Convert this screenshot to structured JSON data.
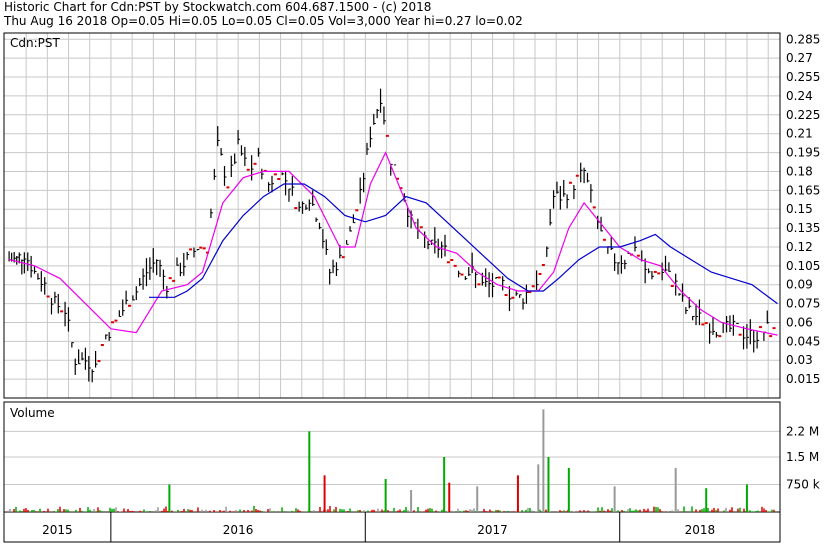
{
  "header": {
    "line1": "Historic Chart for Cdn:PST by Stockwatch.com 604.687.1500 - (c) 2018",
    "line2": "Thu Aug 16 2018  Op=0.05  Hi=0.05  Lo=0.05  Cl=0.05  Vol=3,000  Year hi=0.27  lo=0.02"
  },
  "colors": {
    "background": "#ffffff",
    "grid": "#c8c8c8",
    "price_bars": "#000000",
    "red_ticks": "#dd0000",
    "ma_short": "#ee00ee",
    "ma_long": "#0000cc",
    "volume_up": "#00aa00",
    "volume_down": "#dd0000",
    "volume_neutral": "#999999"
  },
  "chart_data": [
    {
      "type": "line",
      "title": "Cdn:PST",
      "price_label": "Cdn:PST",
      "y_ticks": [
        "0.285",
        "0.27",
        "0.255",
        "0.24",
        "0.225",
        "0.21",
        "0.195",
        "0.18",
        "0.165",
        "0.15",
        "0.135",
        "0.12",
        "0.105",
        "0.09",
        "0.075",
        "0.06",
        "0.045",
        "0.03",
        "0.015"
      ],
      "ylim": [
        0,
        0.29
      ],
      "x_ticks": [
        "2015",
        "2016",
        "2017",
        "2018"
      ],
      "xlim": [
        2015.58,
        2018.63
      ],
      "grid": true,
      "series": [
        {
          "kind": "price_close",
          "x": [
            2015.6,
            2015.63,
            2015.66,
            2015.7,
            2015.74,
            2015.78,
            2015.82,
            2015.86,
            2015.9,
            2015.94,
            2015.98,
            2016.02,
            2016.06,
            2016.1,
            2016.14,
            2016.18,
            2016.22,
            2016.26,
            2016.3,
            2016.34,
            2016.38,
            2016.42,
            2016.46,
            2016.5,
            2016.54,
            2016.58,
            2016.62,
            2016.66,
            2016.7,
            2016.74,
            2016.78,
            2016.82,
            2016.86,
            2016.9,
            2016.94,
            2016.98,
            2017.02,
            2017.06,
            2017.1,
            2017.14,
            2017.18,
            2017.22,
            2017.26,
            2017.3,
            2017.34,
            2017.38,
            2017.42,
            2017.46,
            2017.5,
            2017.54,
            2017.58,
            2017.62,
            2017.66,
            2017.7,
            2017.74,
            2017.78,
            2017.82,
            2017.86,
            2017.9,
            2017.94,
            2017.98,
            2018.02,
            2018.06,
            2018.1,
            2018.14,
            2018.18,
            2018.22,
            2018.26,
            2018.3,
            2018.34,
            2018.38,
            2018.42,
            2018.46,
            2018.5,
            2018.54,
            2018.58,
            2018.62
          ],
          "y": [
            0.11,
            0.11,
            0.115,
            0.1,
            0.09,
            0.075,
            0.07,
            0.03,
            0.03,
            0.025,
            0.05,
            0.06,
            0.075,
            0.085,
            0.1,
            0.11,
            0.09,
            0.1,
            0.11,
            0.12,
            0.12,
            0.2,
            0.17,
            0.2,
            0.18,
            0.19,
            0.17,
            0.18,
            0.17,
            0.15,
            0.16,
            0.14,
            0.1,
            0.11,
            0.13,
            0.16,
            0.21,
            0.24,
            0.19,
            0.17,
            0.14,
            0.13,
            0.12,
            0.12,
            0.11,
            0.1,
            0.1,
            0.09,
            0.09,
            0.09,
            0.08,
            0.08,
            0.09,
            0.1,
            0.16,
            0.16,
            0.17,
            0.18,
            0.15,
            0.12,
            0.11,
            0.11,
            0.12,
            0.1,
            0.1,
            0.1,
            0.09,
            0.07,
            0.065,
            0.06,
            0.055,
            0.055,
            0.055,
            0.05,
            0.05,
            0.055,
            0.05
          ]
        },
        {
          "kind": "moving_average_short",
          "x": [
            2015.6,
            2015.7,
            2015.8,
            2015.9,
            2016.0,
            2016.1,
            2016.2,
            2016.3,
            2016.36,
            2016.44,
            2016.52,
            2016.6,
            2016.7,
            2016.8,
            2016.9,
            2016.96,
            2017.02,
            2017.08,
            2017.14,
            2017.2,
            2017.28,
            2017.36,
            2017.44,
            2017.52,
            2017.6,
            2017.68,
            2017.74,
            2017.8,
            2017.86,
            2017.92,
            2018.0,
            2018.08,
            2018.16,
            2018.24,
            2018.32,
            2018.4,
            2018.5,
            2018.62
          ],
          "y": [
            0.11,
            0.105,
            0.095,
            0.075,
            0.055,
            0.052,
            0.085,
            0.09,
            0.1,
            0.155,
            0.175,
            0.18,
            0.18,
            0.16,
            0.12,
            0.12,
            0.17,
            0.195,
            0.165,
            0.135,
            0.12,
            0.115,
            0.1,
            0.09,
            0.085,
            0.085,
            0.1,
            0.135,
            0.155,
            0.14,
            0.12,
            0.11,
            0.105,
            0.085,
            0.07,
            0.06,
            0.055,
            0.05
          ]
        },
        {
          "kind": "moving_average_long",
          "x": [
            2016.15,
            2016.25,
            2016.3,
            2016.36,
            2016.44,
            2016.52,
            2016.6,
            2016.68,
            2016.76,
            2016.84,
            2016.92,
            2017.0,
            2017.08,
            2017.16,
            2017.24,
            2017.32,
            2017.4,
            2017.48,
            2017.56,
            2017.64,
            2017.7,
            2017.76,
            2017.84,
            2017.92,
            2018.0,
            2018.08,
            2018.14,
            2018.2,
            2018.28,
            2018.36,
            2018.44,
            2018.52,
            2018.62
          ],
          "y": [
            0.08,
            0.08,
            0.085,
            0.095,
            0.125,
            0.145,
            0.16,
            0.17,
            0.17,
            0.16,
            0.145,
            0.14,
            0.145,
            0.16,
            0.155,
            0.14,
            0.125,
            0.11,
            0.095,
            0.085,
            0.085,
            0.095,
            0.11,
            0.12,
            0.12,
            0.125,
            0.13,
            0.12,
            0.11,
            0.1,
            0.095,
            0.09,
            0.075
          ]
        }
      ]
    },
    {
      "type": "bar",
      "title": "Volume",
      "volume_label": "Volume",
      "y_ticks": [
        "2.2 M",
        "1.5 M",
        "750 k"
      ],
      "ylim": [
        0,
        3000000
      ],
      "x_ticks": [
        "2015",
        "2016",
        "2017",
        "2018"
      ],
      "spikes": [
        {
          "x": 2016.23,
          "value": 750000,
          "color": "up"
        },
        {
          "x": 2016.78,
          "value": 2200000,
          "color": "up"
        },
        {
          "x": 2016.84,
          "value": 1000000,
          "color": "down"
        },
        {
          "x": 2017.08,
          "value": 900000,
          "color": "up"
        },
        {
          "x": 2017.18,
          "value": 600000,
          "color": "neutral"
        },
        {
          "x": 2017.31,
          "value": 1500000,
          "color": "up"
        },
        {
          "x": 2017.33,
          "value": 800000,
          "color": "down"
        },
        {
          "x": 2017.44,
          "value": 700000,
          "color": "neutral"
        },
        {
          "x": 2017.6,
          "value": 1000000,
          "color": "down"
        },
        {
          "x": 2017.68,
          "value": 1300000,
          "color": "neutral"
        },
        {
          "x": 2017.7,
          "value": 2800000,
          "color": "neutral"
        },
        {
          "x": 2017.72,
          "value": 1500000,
          "color": "up"
        },
        {
          "x": 2017.8,
          "value": 1200000,
          "color": "up"
        },
        {
          "x": 2017.98,
          "value": 700000,
          "color": "neutral"
        },
        {
          "x": 2018.22,
          "value": 1200000,
          "color": "neutral"
        },
        {
          "x": 2018.34,
          "value": 650000,
          "color": "up"
        },
        {
          "x": 2018.5,
          "value": 750000,
          "color": "up"
        }
      ]
    }
  ]
}
